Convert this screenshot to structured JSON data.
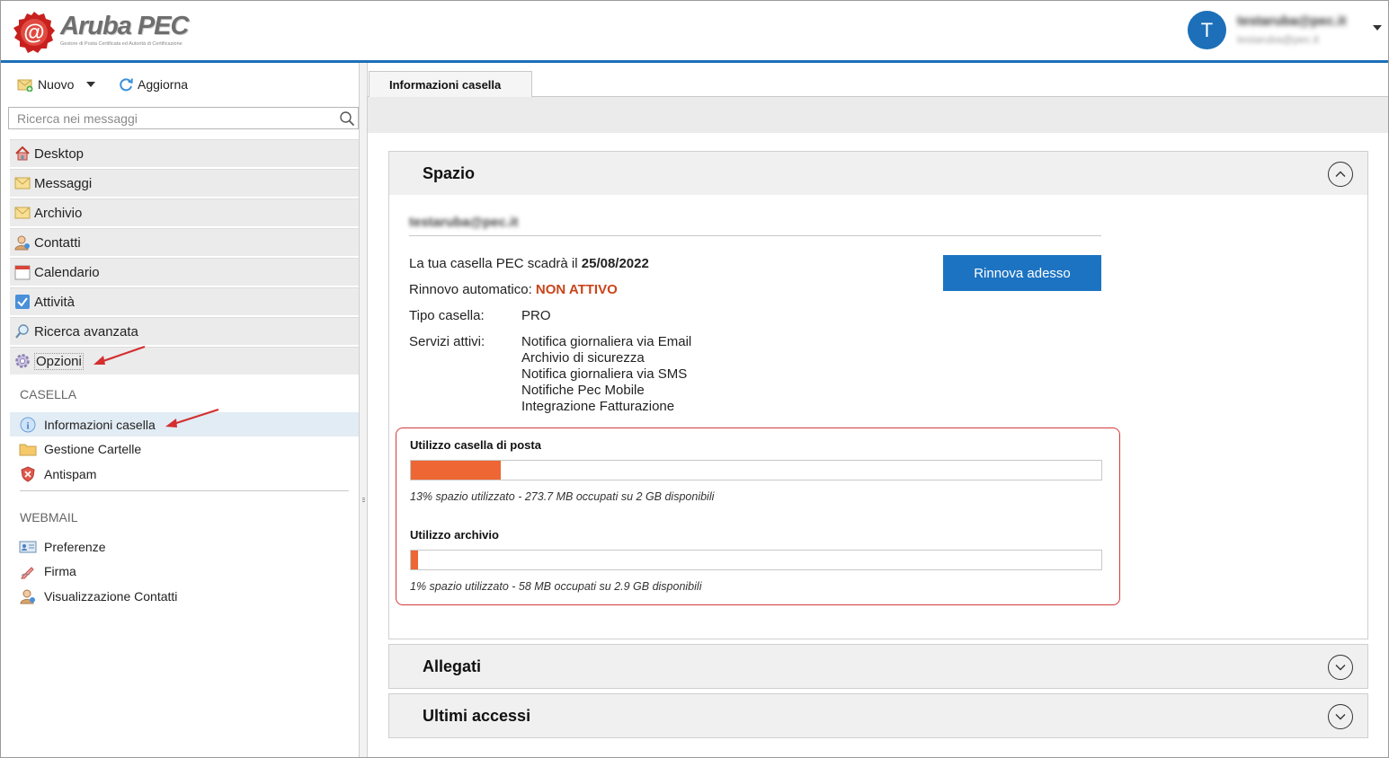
{
  "header": {
    "logo_text": "Aruba PEC",
    "logo_subtitle": "Gestore di Posta Certificata ed Autorità di Certificazione",
    "avatar_letter": "T",
    "user_name": "testaruba@pec.it",
    "user_email": "testaruba@pec.it"
  },
  "toolbar": {
    "new_label": "Nuovo",
    "refresh_label": "Aggiorna"
  },
  "search": {
    "placeholder": "Ricerca nei messaggi"
  },
  "nav": [
    {
      "label": "Desktop",
      "icon": "home-icon"
    },
    {
      "label": "Messaggi",
      "icon": "envelope-icon"
    },
    {
      "label": "Archivio",
      "icon": "archive-icon"
    },
    {
      "label": "Contatti",
      "icon": "contacts-icon"
    },
    {
      "label": "Calendario",
      "icon": "calendar-icon"
    },
    {
      "label": "Attività",
      "icon": "task-checkbox-icon"
    },
    {
      "label": "Ricerca avanzata",
      "icon": "magnifier-icon"
    },
    {
      "label": "Opzioni",
      "icon": "gear-icon"
    }
  ],
  "casella": {
    "title": "CASELLA",
    "items": [
      "Informazioni casella",
      "Gestione Cartelle",
      "Antispam"
    ]
  },
  "webmail": {
    "title": "WEBMAIL",
    "items": [
      "Preferenze",
      "Firma",
      "Visualizzazione Contatti"
    ]
  },
  "main": {
    "tab_label": "Informazioni casella",
    "spazio": {
      "title": "Spazio",
      "email": "testaruba@pec.it",
      "expiry_text": "La tua casella PEC scadrà il ",
      "expiry_date": "25/08/2022",
      "renew_label": "Rinnovo automatico: ",
      "renew_status": "NON ATTIVO",
      "type_label": "Tipo casella:",
      "type_value": "PRO",
      "services_label": "Servizi attivi:",
      "services": [
        "Notifica giornaliera via Email",
        "Archivio di sicurezza",
        "Notifica giornaliera via SMS",
        "Notifiche Pec Mobile",
        "Integrazione Fatturazione"
      ],
      "renew_button": "Rinnova adesso",
      "mailbox_usage": {
        "title": "Utilizzo casella di posta",
        "percent": 13,
        "note": "13% spazio utilizzato - 273.7 MB occupati su 2 GB disponibili"
      },
      "archive_usage": {
        "title": "Utilizzo archivio",
        "percent": 1,
        "note": "1% spazio utilizzato - 58 MB occupati su 2.9 GB disponibili"
      }
    },
    "allegati_title": "Allegati",
    "accessi_title": "Ultimi accessi"
  },
  "colors": {
    "brand_blue": "#1c6fb8",
    "button_blue": "#1c73c2",
    "status_orange": "#c8451b",
    "usage_fill": "#ee6633",
    "highlight_red": "#d33a3a"
  }
}
